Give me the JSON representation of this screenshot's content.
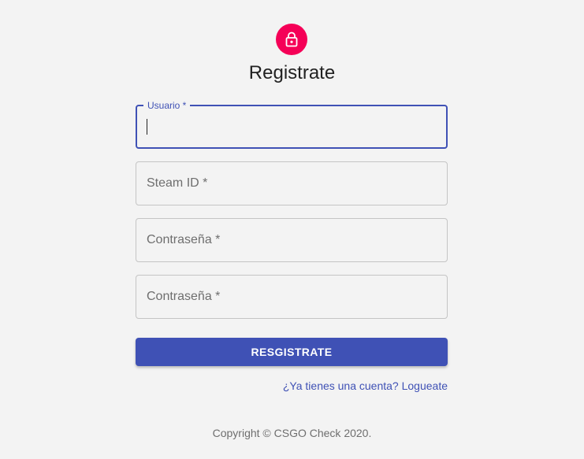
{
  "header": {
    "title": "Registrate",
    "icon": "lock-icon",
    "icon_bg_color": "#f50057"
  },
  "form": {
    "username": {
      "label": "Usuario *",
      "value": ""
    },
    "steam_id": {
      "label": "Steam ID *",
      "value": ""
    },
    "password": {
      "label": "Contraseña *",
      "value": ""
    },
    "password_confirm": {
      "label": "Contraseña *",
      "value": ""
    },
    "submit_label": "RESGISTRATE",
    "accent_color": "#3f51b5"
  },
  "links": {
    "login": "¿Ya tienes una cuenta? Logueate"
  },
  "footer": {
    "copyright": "Copyright © CSGO Check 2020."
  }
}
